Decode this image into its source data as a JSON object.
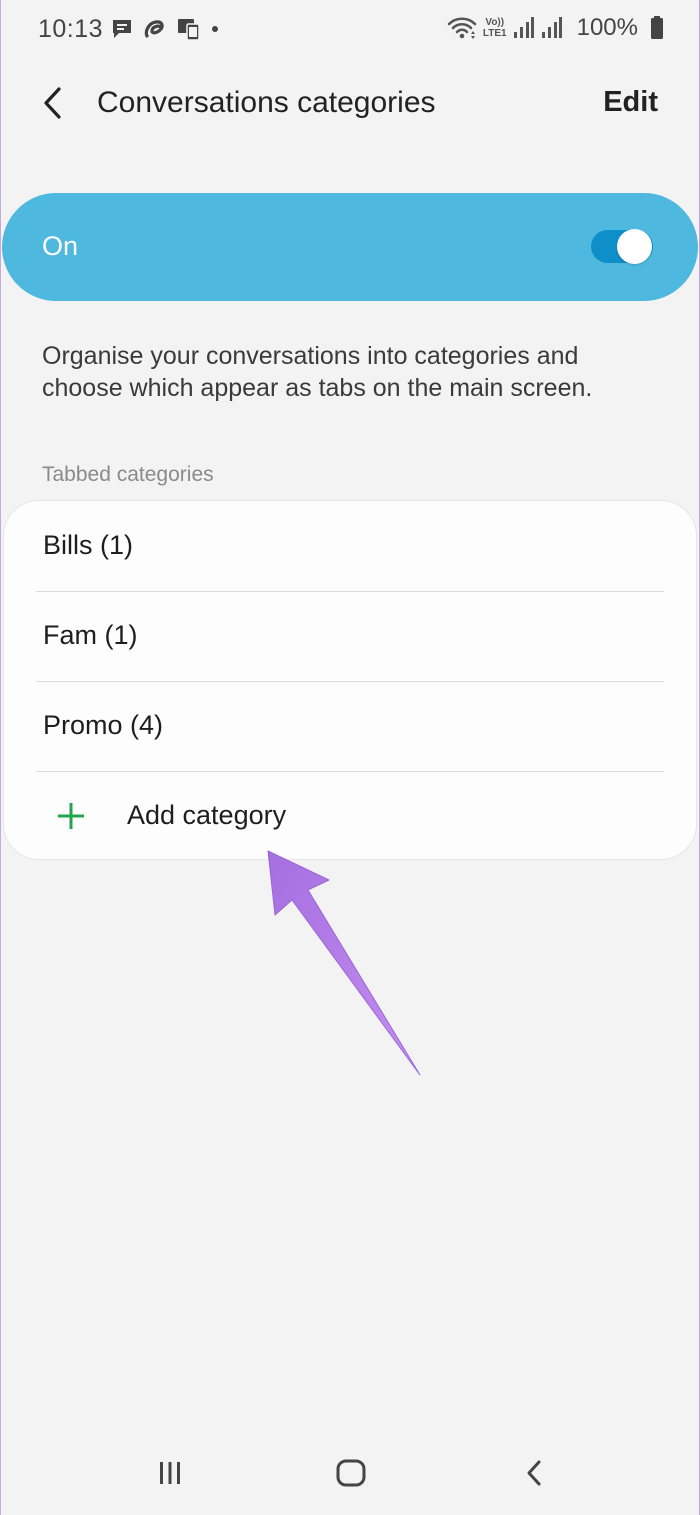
{
  "status_bar": {
    "time": "10:13",
    "battery_percent": "100%",
    "network_label_top": "Vo))",
    "network_label_bottom": "LTE1"
  },
  "header": {
    "title": "Conversations categories",
    "edit_label": "Edit"
  },
  "toggle": {
    "label": "On",
    "state": "on",
    "card_color": "#4fb8df",
    "switch_color": "#0f8fc9"
  },
  "description": "Organise your conversations into categories and choose which appear as tabs on the main screen.",
  "tabbed_section": {
    "label": "Tabbed categories",
    "items": [
      {
        "label": "Bills (1)"
      },
      {
        "label": "Fam (1)"
      },
      {
        "label": "Promo (4)"
      }
    ],
    "add_label": "Add category",
    "add_icon_color": "#21a650"
  },
  "annotation": {
    "color": "#b57ee6"
  }
}
